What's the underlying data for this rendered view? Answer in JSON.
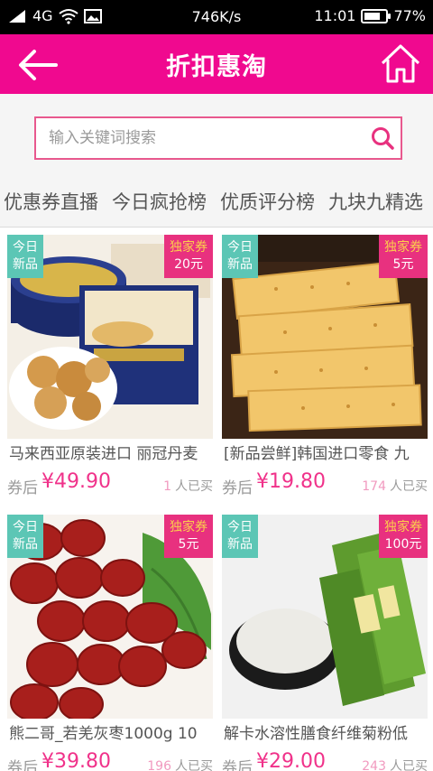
{
  "status_bar": {
    "network": "4G",
    "speed": "746K/s",
    "time": "11:01",
    "battery": "77%",
    "battery_level": 0.77
  },
  "app_bar": {
    "title": "折扣惠淘",
    "back_icon": "arrow-left-icon",
    "home_icon": "home-icon"
  },
  "search": {
    "placeholder": "输入关键词搜索",
    "icon": "search-icon"
  },
  "tabs": [
    {
      "label": "优惠券直播"
    },
    {
      "label": "今日疯抢榜"
    },
    {
      "label": "优质评分榜"
    },
    {
      "label": "九块九精选"
    }
  ],
  "products": [
    {
      "badge_new": [
        "今日",
        "新品"
      ],
      "coupon_tag": "独家券",
      "coupon_value": "20元",
      "name": "马来西亚原装进口 丽冠丹麦",
      "price_prefix": "券后",
      "price": "¥49.90",
      "sold_count": "1",
      "sold_suffix": "人已买"
    },
    {
      "badge_new": [
        "今日",
        "新品"
      ],
      "coupon_tag": "独家券",
      "coupon_value": "5元",
      "name": "[新品尝鲜]韩国进口零食 九",
      "price_prefix": "券后",
      "price": "¥19.80",
      "sold_count": "174",
      "sold_suffix": "人已买"
    },
    {
      "badge_new": [
        "今日",
        "新品"
      ],
      "coupon_tag": "独家券",
      "coupon_value": "5元",
      "name": "熊二哥_若羌灰枣1000g 10",
      "price_prefix": "券后",
      "price": "¥39.80",
      "sold_count": "196",
      "sold_suffix": "人已买"
    },
    {
      "badge_new": [
        "今日",
        "新品"
      ],
      "coupon_tag": "独家券",
      "coupon_value": "100元",
      "name": "解卡水溶性膳食纤维菊粉低",
      "price_prefix": "券后",
      "price": "¥29.00",
      "sold_count": "243",
      "sold_suffix": "人已买"
    }
  ],
  "colors": {
    "brand_pink": "#f0098f",
    "coupon_red": "#e8317f",
    "new_teal": "#5cc6b5",
    "coupon_yellow": "#fbd04c"
  }
}
